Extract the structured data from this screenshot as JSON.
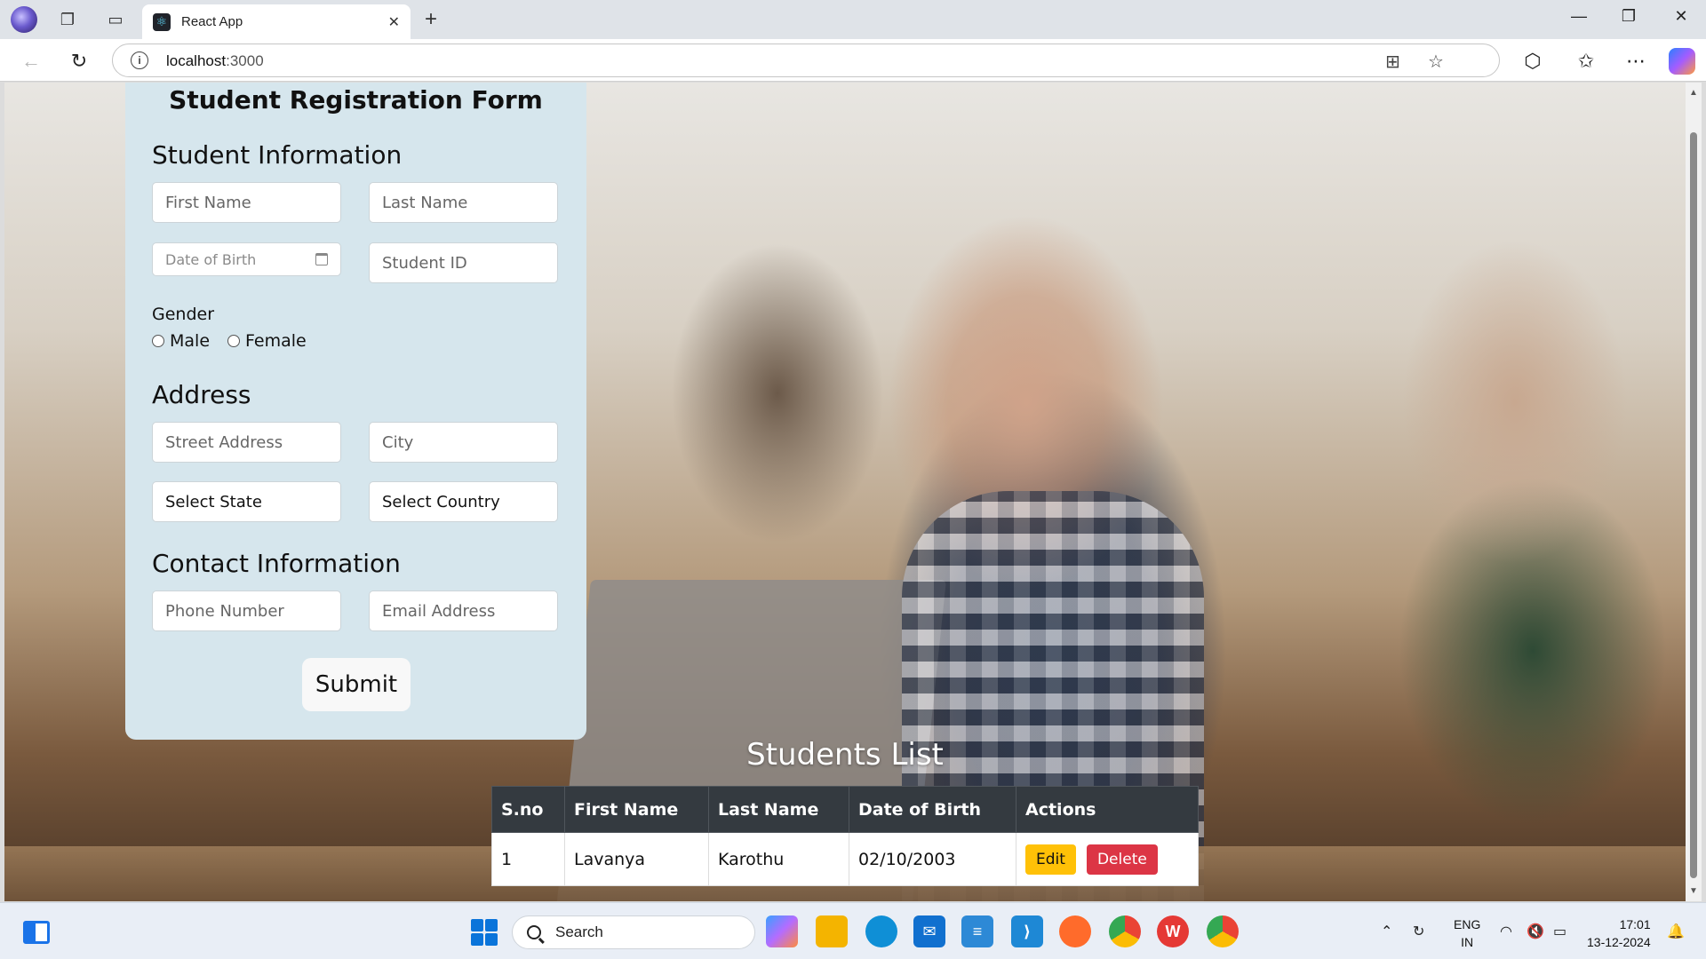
{
  "browser": {
    "tab_title": "React App",
    "tab_close": "✕",
    "new_tab": "+",
    "url_host": "localhost",
    "url_port": ":3000"
  },
  "form": {
    "title": "Student Registration Form",
    "student_info_heading": "Student Information",
    "first_name_placeholder": "First Name",
    "last_name_placeholder": "Last Name",
    "dob_placeholder": "Date of Birth",
    "student_id_placeholder": "Student ID",
    "gender_label": "Gender",
    "gender_male": "Male",
    "gender_female": "Female",
    "address_heading": "Address",
    "street_placeholder": "Street Address",
    "city_placeholder": "City",
    "state_select": "Select State",
    "country_select": "Select Country",
    "contact_heading": "Contact Information",
    "phone_placeholder": "Phone Number",
    "email_placeholder": "Email Address",
    "submit_label": "Submit"
  },
  "students_list": {
    "title": "Students List",
    "columns": [
      "S.no",
      "First Name",
      "Last Name",
      "Date of Birth",
      "Actions"
    ],
    "rows": [
      {
        "sno": "1",
        "first_name": "Lavanya",
        "last_name": "Karothu",
        "dob": "02/10/2003",
        "edit_label": "Edit",
        "delete_label": "Delete"
      }
    ]
  },
  "taskbar": {
    "search_label": "Search",
    "lang_top": "ENG",
    "lang_bottom": "IN",
    "time": "17:01",
    "date": "13-12-2024"
  },
  "colors": {
    "form_bg": "#d6e6ed",
    "table_header_bg": "#343a40",
    "edit_btn": "#ffc107",
    "delete_btn": "#dc3545"
  }
}
